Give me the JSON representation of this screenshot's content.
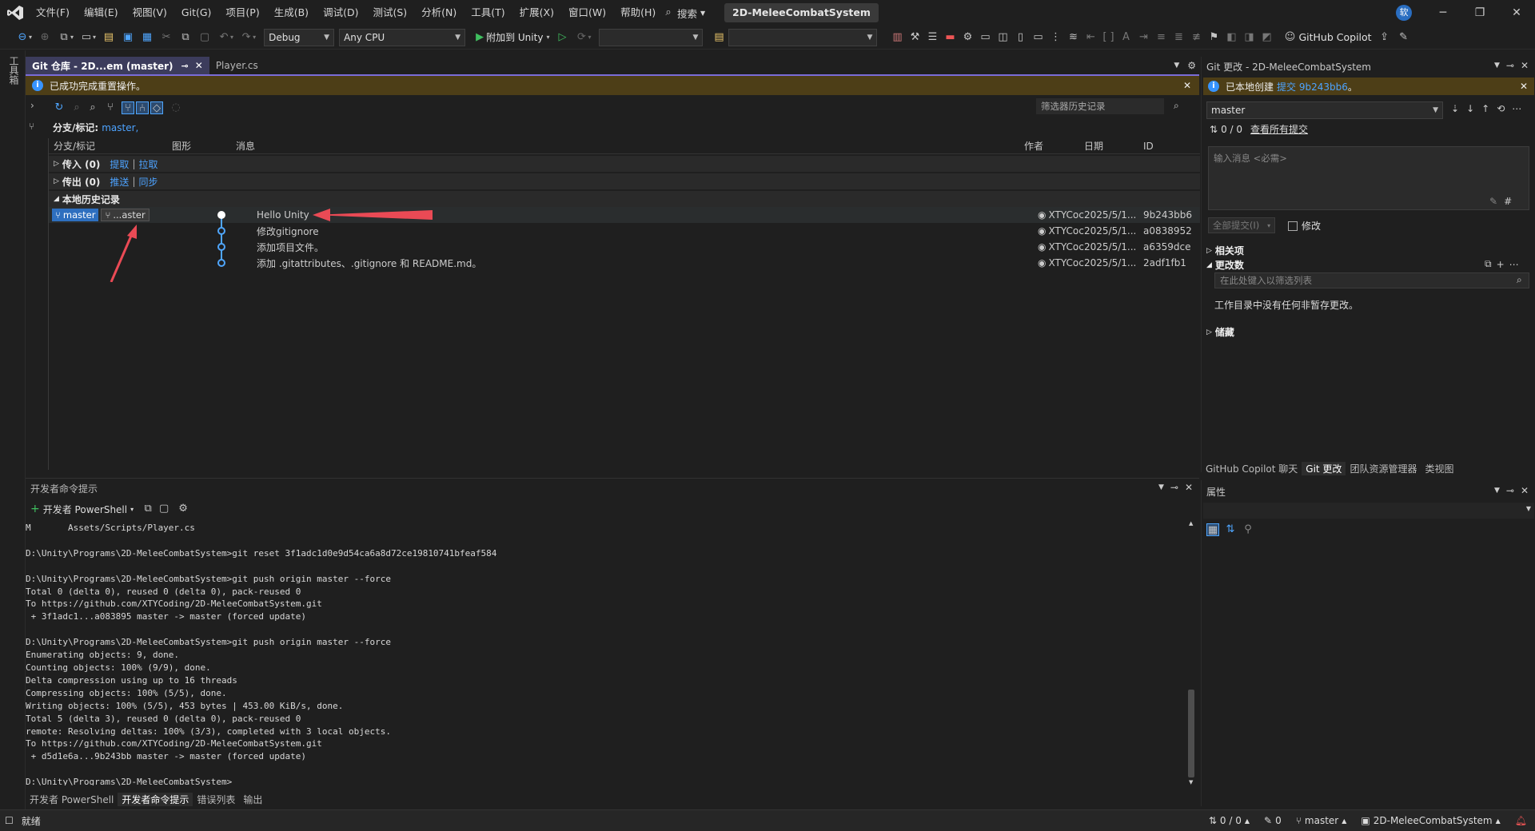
{
  "menu": [
    "文件(F)",
    "编辑(E)",
    "视图(V)",
    "Git(G)",
    "项目(P)",
    "生成(B)",
    "调试(D)",
    "测试(S)",
    "分析(N)",
    "工具(T)",
    "扩展(X)",
    "窗口(W)",
    "帮助(H)"
  ],
  "search_label": "搜索",
  "solution_title": "2D-MeleeCombatSystem",
  "avatar_initial": "软",
  "toolbar": {
    "config": "Debug",
    "platform": "Any CPU",
    "attach": "附加到 Unity",
    "copilot": "GitHub Copilot"
  },
  "left_strip": {
    "toolbox": "工具箱"
  },
  "doc_tabs": [
    {
      "label": "Git 仓库 - 2D...em (master)"
    },
    {
      "label": "Player.cs"
    }
  ],
  "git_repo": {
    "info": "已成功完成重置操作。",
    "filter_placeholder": "筛选器历史记录",
    "branch_tag_label": "分支/标记:",
    "branch_tag_value": "master,",
    "headers": {
      "branch": "分支/标记",
      "graph": "图形",
      "message": "消息",
      "author": "作者",
      "date": "日期",
      "id": "ID"
    },
    "incoming": {
      "label": "传入 (0)",
      "link1": "提取",
      "link2": "拉取"
    },
    "outgoing": {
      "label": "传出 (0)",
      "link1": "推送",
      "link2": "同步"
    },
    "local_history": "本地历史记录",
    "chips": [
      "master",
      "...aster"
    ],
    "commits": [
      {
        "message": "Hello Unity",
        "author": "XTYCoc",
        "date": "2025/5/1...",
        "id": "9b243bb6"
      },
      {
        "message": "修改gitignore",
        "author": "XTYCoc",
        "date": "2025/5/1...",
        "id": "a0838952"
      },
      {
        "message": "添加项目文件。",
        "author": "XTYCoc",
        "date": "2025/5/1...",
        "id": "a6359dce"
      },
      {
        "message": "添加 .gitattributes、.gitignore 和 README.md。",
        "author": "XTYCoc",
        "date": "2025/5/1...",
        "id": "2adf1fb1"
      }
    ]
  },
  "terminal": {
    "title": "开发者命令提示",
    "new_shell": "开发者 PowerShell",
    "lines": [
      "M       Assets/Scripts/Player.cs",
      "",
      "D:\\Unity\\Programs\\2D-MeleeCombatSystem>git reset 3f1adc1d0e9d54ca6a8d72ce19810741bfeaf584",
      "",
      "D:\\Unity\\Programs\\2D-MeleeCombatSystem>git push origin master --force",
      "Total 0 (delta 0), reused 0 (delta 0), pack-reused 0",
      "To https://github.com/XTYCoding/2D-MeleeCombatSystem.git",
      " + 3f1adc1...a083895 master -> master (forced update)",
      "",
      "D:\\Unity\\Programs\\2D-MeleeCombatSystem>git push origin master --force",
      "Enumerating objects: 9, done.",
      "Counting objects: 100% (9/9), done.",
      "Delta compression using up to 16 threads",
      "Compressing objects: 100% (5/5), done.",
      "Writing objects: 100% (5/5), 453 bytes | 453.00 KiB/s, done.",
      "Total 5 (delta 3), reused 0 (delta 0), pack-reused 0",
      "remote: Resolving deltas: 100% (3/3), completed with 3 local objects.",
      "To https://github.com/XTYCoding/2D-MeleeCombatSystem.git",
      " + d5d1e6a...9b243bb master -> master (forced update)",
      "",
      "D:\\Unity\\Programs\\2D-MeleeCombatSystem>"
    ],
    "tabs": [
      "开发者 PowerShell",
      "开发者命令提示",
      "错误列表",
      "输出"
    ]
  },
  "git_changes": {
    "title": "Git 更改 - 2D-MeleeCombatSystem",
    "info_prefix": "已本地创建",
    "info_link": "提交 9b243bb6",
    "info_suffix": "。",
    "branch": "master",
    "sync": "0 / 0",
    "view_all": "查看所有提交",
    "message_placeholder": "输入消息 <必需>",
    "commit_all": "全部提交(I)",
    "amend": "修改",
    "related": "相关项",
    "changes": "更改数",
    "filter_placeholder": "在此处键入以筛选列表",
    "no_changes": "工作目录中没有任何非暂存更改。",
    "stash": "储藏",
    "tabs": [
      "GitHub Copilot 聊天",
      "Git 更改",
      "团队资源管理器",
      "类视图"
    ]
  },
  "properties": {
    "title": "属性"
  },
  "status": {
    "ready": "就绪",
    "sync": "0 / 0",
    "edits": "0",
    "branch": "master",
    "repo": "2D-MeleeCombatSystem"
  }
}
